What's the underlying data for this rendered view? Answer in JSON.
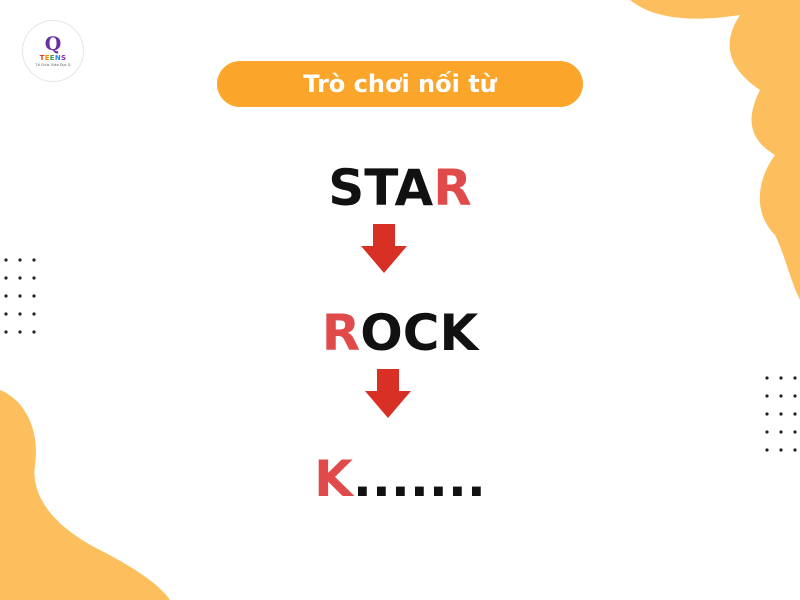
{
  "logo": {
    "letter": "Q",
    "name": "TEENS",
    "tagline": "Tổ Chức Giáo Dục Q"
  },
  "title": "Trò chơi nối từ",
  "words": [
    {
      "highlight_first": "",
      "rest": "STA",
      "highlight_last": "R"
    },
    {
      "highlight_first": "R",
      "rest": "OCK",
      "highlight_last": ""
    },
    {
      "highlight_first": "K",
      "rest": ".......",
      "highlight_last": ""
    }
  ],
  "colors": {
    "accent_orange": "#fba52a",
    "blob_orange": "#fdbf5e",
    "highlight_red": "#e04a4a",
    "arrow_red": "#d93025",
    "text_black": "#111111"
  },
  "icons": [
    "down-arrow-icon",
    "down-arrow-icon"
  ]
}
